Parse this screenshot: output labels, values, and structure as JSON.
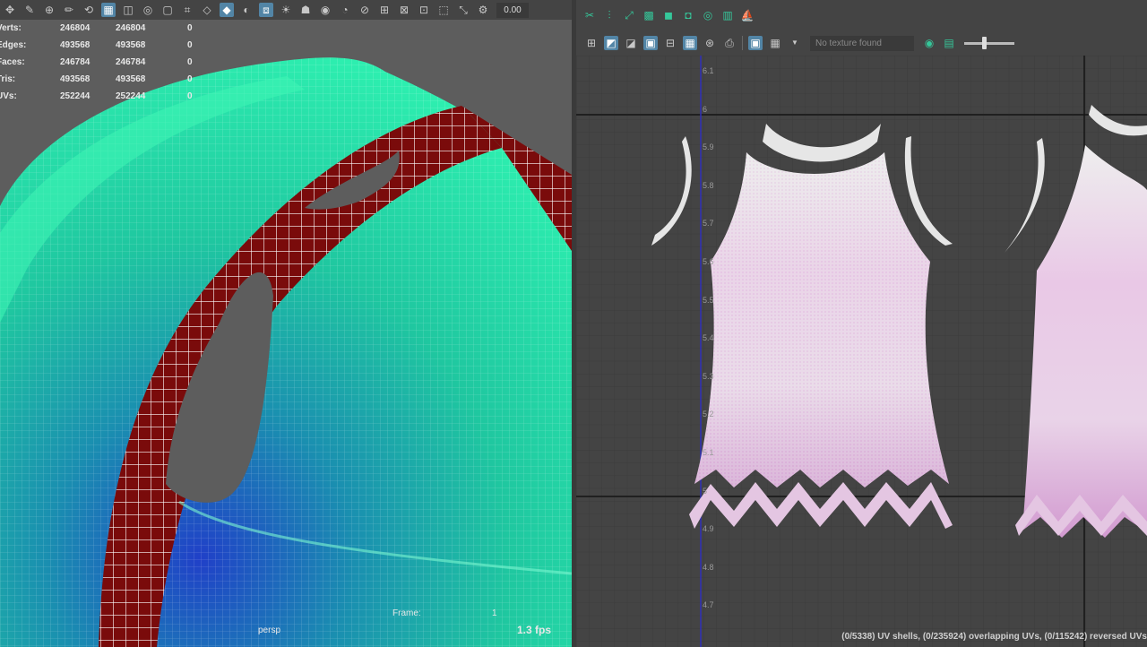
{
  "viewport": {
    "toolbar_icons": [
      "move-icon",
      "edit-icon",
      "snap-icon",
      "pencil-icon",
      "manip-icon",
      "grid-icon",
      "camera-icon",
      "view-icon",
      "gate-icon",
      "region-icon",
      "wire-icon",
      "shaded-icon",
      "smooth-icon",
      "xray-icon",
      "light-icon",
      "shadow-icon",
      "ao-icon",
      "aa-icon",
      "dof-icon",
      "isolate-icon",
      "xray-joint-icon",
      "isolate-select-icon",
      "frame-icon",
      "resolution-icon",
      "exposure-icon"
    ],
    "exposure_value": "0.00",
    "hud": {
      "rows": [
        {
          "label": "Verts:",
          "v1": "246804",
          "v2": "246804",
          "v3": "0"
        },
        {
          "label": "Edges:",
          "v1": "493568",
          "v2": "493568",
          "v3": "0"
        },
        {
          "label": "Faces:",
          "v1": "246784",
          "v2": "246784",
          "v3": "0"
        },
        {
          "label": "Tris:",
          "v1": "493568",
          "v2": "493568",
          "v3": "0"
        },
        {
          "label": "UVs:",
          "v1": "252244",
          "v2": "252244",
          "v3": "0"
        }
      ]
    },
    "camera_label": "persp",
    "frame_label": "Frame:",
    "frame_value": "1",
    "fps": "1.3 fps"
  },
  "uv_editor": {
    "toolbar_top_icons": [
      "uv-cut-icon",
      "uv-sew-icon",
      "uv-unfold-icon",
      "uv-layout-icon",
      "uv-shell-icon",
      "uv-texel-icon",
      "uv-orient-icon",
      "uv-sets-icon",
      "uv-symmetry-icon"
    ],
    "toolbar_second_icons": [
      "uv-grid-icon",
      "uv-shaded-icon",
      "uv-distort-icon",
      "uv-border-icon",
      "uv-tile-icon",
      "uv-pixel-icon",
      "uv-snapshot-icon",
      "uv-image-icon"
    ],
    "texture_placeholder": "No texture found",
    "axis_labels": [
      "6.1",
      "6",
      "5.9",
      "5.8",
      "5.7",
      "5.6",
      "5.5",
      "5.4",
      "5.3",
      "5.2",
      "5.1",
      "5",
      "4.9",
      "4.8",
      "4.7"
    ],
    "status": "(0/5338) UV shells, (0/235924) overlapping UVs, (0/115242) reversed UVs"
  }
}
